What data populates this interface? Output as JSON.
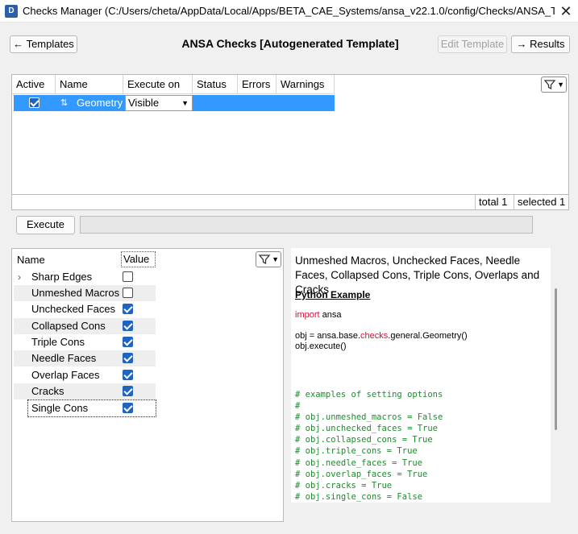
{
  "window": {
    "title": "Checks Manager (C:/Users/cheta/AppData/Local/Apps/BETA_CAE_Systems/ansa_v22.1.0/config/Checks/ANSA_Templates....",
    "app_icon_letter": "D",
    "close_glyph": "✕"
  },
  "toolbar": {
    "templates_label": "Templates",
    "templates_arrow": "←",
    "page_title": "ANSA Checks [Autogenerated Template]",
    "edit_template_label": "Edit Template",
    "results_label": "Results",
    "results_arrow": "→"
  },
  "checks_table": {
    "columns": [
      "Active",
      "Name",
      "Execute on",
      "Status",
      "Errors",
      "Warnings"
    ],
    "rows": [
      {
        "active": true,
        "name": "Geometry",
        "execute_on": "Visible",
        "status": "",
        "errors": "",
        "warnings": ""
      }
    ],
    "selected_color": "#3399ff"
  },
  "status": {
    "total": "total 1",
    "selected": "selected 1"
  },
  "execute_label": "Execute",
  "options": {
    "header_name": "Name",
    "header_value": "Value",
    "items": [
      {
        "label": "Sharp Edges",
        "checked": false,
        "expandable": true
      },
      {
        "label": "Unmeshed Macros",
        "checked": false
      },
      {
        "label": "Unchecked Faces",
        "checked": true
      },
      {
        "label": "Collapsed Cons",
        "checked": true
      },
      {
        "label": "Triple Cons",
        "checked": true
      },
      {
        "label": "Needle Faces",
        "checked": true
      },
      {
        "label": "Overlap Faces",
        "checked": true
      },
      {
        "label": "Cracks",
        "checked": true
      },
      {
        "label": "Single Cons",
        "checked": true
      }
    ]
  },
  "description": {
    "text": "Unmeshed Macros, Unchecked Faces, Needle Faces, Collapsed Cons, Triple Cons, Overlaps and Cracks",
    "python_example_title": "Python Example",
    "code_import_kw": "import",
    "code_import_mod": " ansa",
    "code_obj_prefix": "obj = ansa.base.",
    "code_obj_kw": "checks",
    "code_obj_suffix": ".general.Geometry()",
    "code_exec": "obj.execute()",
    "comments": [
      "# examples of setting options",
      "#",
      "# obj.unmeshed_macros = False",
      "# obj.unchecked_faces = True",
      "# obj.collapsed_cons = True",
      "# obj.triple_cons = True",
      "# obj.needle_faces = True",
      "# obj.overlap_faces = True",
      "# obj.cracks = True",
      "# obj.single_cons = False"
    ]
  }
}
